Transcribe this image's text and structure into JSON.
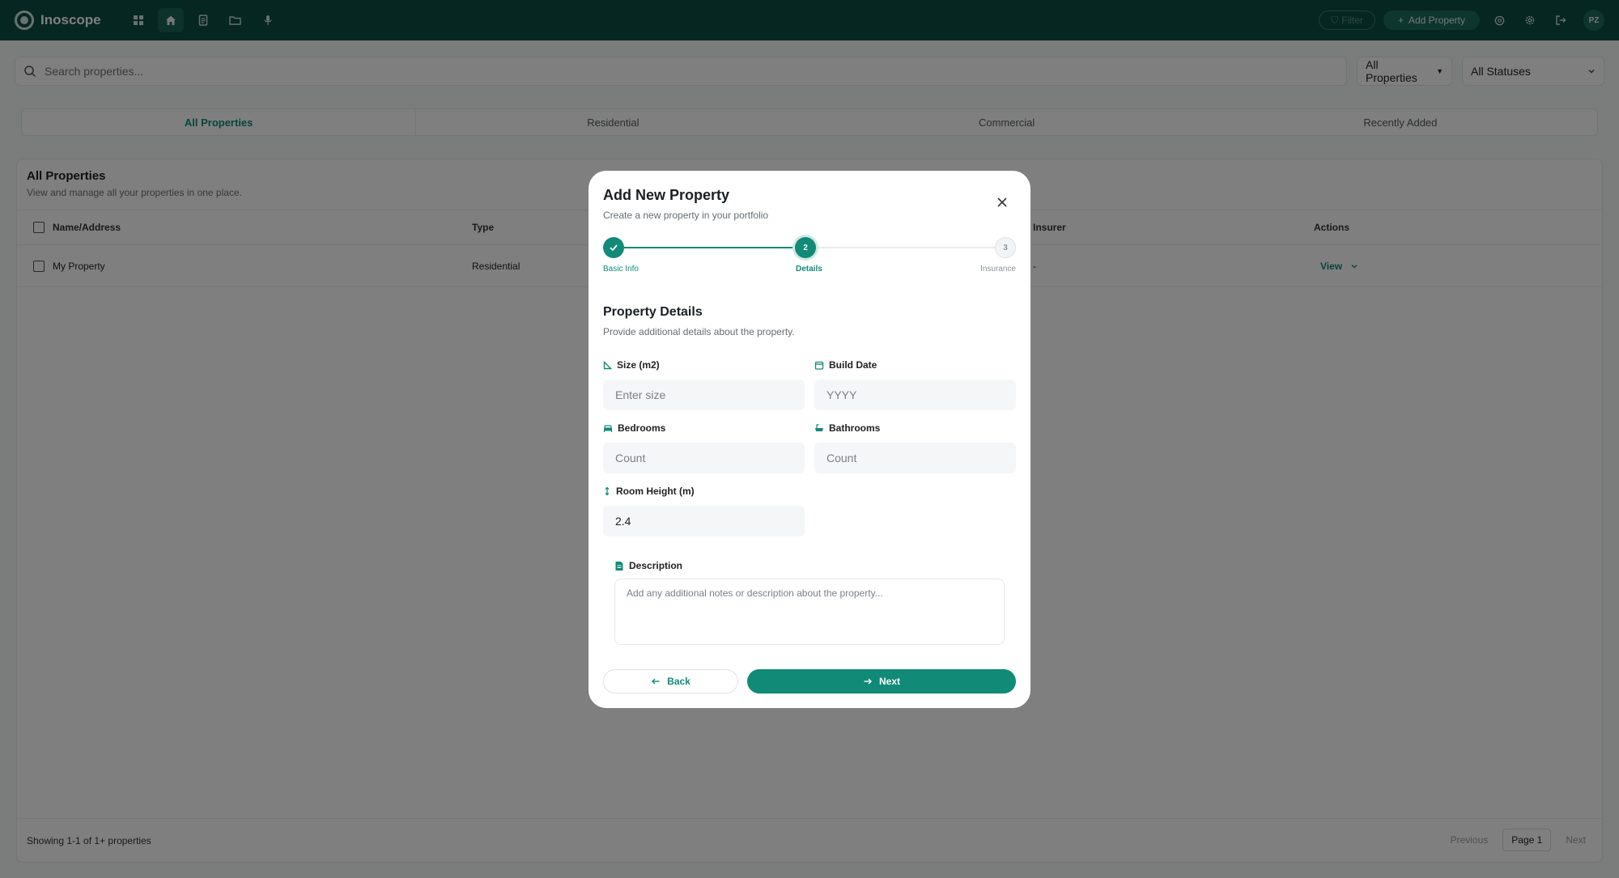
{
  "app": {
    "name": "Inoscope",
    "user_initials": "PZ"
  },
  "topbar": {
    "filter_label": "Filter",
    "add_property_label": "Add Property"
  },
  "search": {
    "placeholder": "Search properties..."
  },
  "filters": {
    "type_selected": "All Properties",
    "status_selected": "All Statuses"
  },
  "tabs": [
    {
      "label": "All Properties",
      "active": true
    },
    {
      "label": "Residential",
      "active": false
    },
    {
      "label": "Commercial",
      "active": false
    },
    {
      "label": "Recently Added",
      "active": false
    }
  ],
  "table": {
    "title": "All Properties",
    "subtitle": "View and manage all your properties in one place.",
    "columns": [
      "Name/Address",
      "Type",
      "Insurer",
      "Actions"
    ],
    "rows": [
      {
        "name": "My Property",
        "type": "Residential",
        "insurer": "-",
        "action": "View"
      }
    ],
    "showing": "Showing 1-1 of 1+ properties",
    "pager": {
      "previous": "Previous",
      "current": "Page 1",
      "next": "Next"
    }
  },
  "modal": {
    "title": "Add New Property",
    "subtitle": "Create a new property in your portfolio",
    "steps": [
      {
        "label": "Basic Info",
        "marker": "",
        "state": "done"
      },
      {
        "label": "Details",
        "marker": "2",
        "state": "current"
      },
      {
        "label": "Insurance",
        "marker": "3",
        "state": "upcoming"
      }
    ],
    "section_title": "Property Details",
    "section_subtitle": "Provide additional details about the property.",
    "fields": {
      "size": {
        "label": "Size (m2)",
        "placeholder": "Enter size",
        "value": ""
      },
      "build_date": {
        "label": "Build Date",
        "placeholder": "YYYY",
        "value": ""
      },
      "bedrooms": {
        "label": "Bedrooms",
        "placeholder": "Count",
        "value": ""
      },
      "bathrooms": {
        "label": "Bathrooms",
        "placeholder": "Count",
        "value": ""
      },
      "room_height": {
        "label": "Room Height (m)",
        "placeholder": "",
        "value": "2.4"
      }
    },
    "description": {
      "label": "Description",
      "placeholder": "Add any additional notes or description about the property..."
    },
    "back_label": "Back",
    "next_label": "Next"
  },
  "colors": {
    "topbar": "#0c4d43",
    "accent": "#118a78",
    "overlay": "rgba(0,0,0,0.5)"
  }
}
